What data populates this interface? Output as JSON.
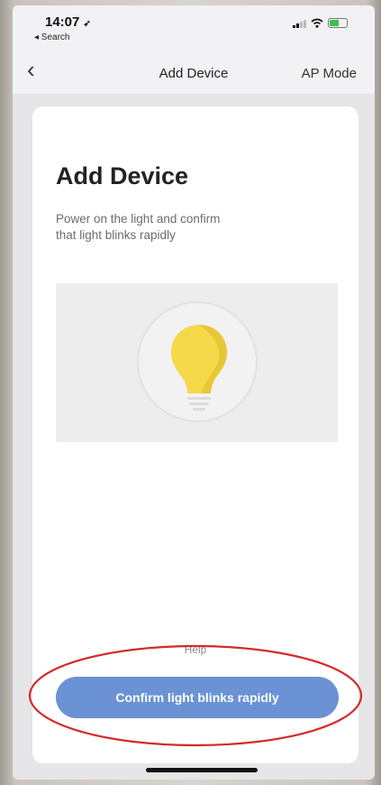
{
  "status_bar": {
    "time": "14:07",
    "back_to_app": "◂ Search",
    "icons": [
      "location-arrow-icon",
      "signal-icon",
      "wifi-icon",
      "battery-icon"
    ],
    "battery_color": "#3cc24a"
  },
  "nav_bar": {
    "back_icon": "chevron-left-icon",
    "title": "Add Device",
    "right_label": "AP Mode"
  },
  "card": {
    "title": "Add Device",
    "instruction": "Power on the light and confirm\nthat light blinks  rapidly",
    "illustration_icon": "light-bulb-icon",
    "help_label": "Help",
    "confirm_label": "Confirm light blinks rapidly"
  },
  "colors": {
    "accent": "#6a92d4",
    "bulb": "#f5d94a",
    "annotation": "#d42a2a"
  }
}
